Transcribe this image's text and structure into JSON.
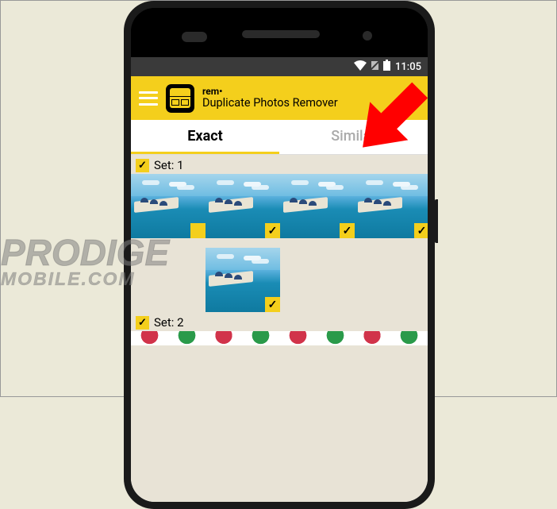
{
  "statusbar": {
    "time": "11:05"
  },
  "appbar": {
    "brand": "rem•",
    "title": "Duplicate Photos Remover"
  },
  "tabs": {
    "exact": "Exact",
    "similar": "Similar"
  },
  "sets": {
    "set1_label": "Set: 1",
    "set2_label": "Set: 2"
  },
  "watermark": {
    "line1": "PRODIGE",
    "line2": "MOBILE.COM"
  }
}
